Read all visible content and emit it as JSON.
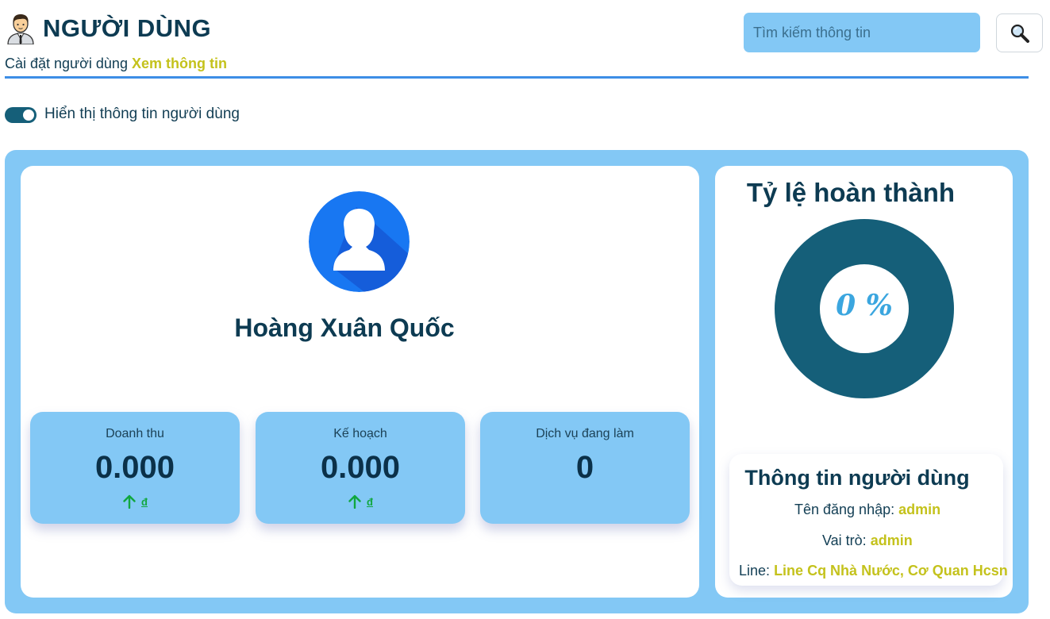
{
  "header": {
    "icon": "person-icon",
    "title": "NGƯỜI DÙNG",
    "breadcrumb_prefix": "Cài đặt người dùng",
    "breadcrumb_active": "Xem thông tin"
  },
  "search": {
    "placeholder": "Tìm kiếm thông tin",
    "value": "",
    "button_icon": "search-icon"
  },
  "toggle": {
    "label": "Hiển thị thông tin người dùng",
    "on": true
  },
  "profile": {
    "name": "Hoàng Xuân Quốc",
    "avatar_icon": "user-avatar-icon"
  },
  "stats": [
    {
      "label": "Doanh thu",
      "value": "0.000",
      "trend_icon": "arrow-up-icon",
      "currency": "đ"
    },
    {
      "label": "Kế hoạch",
      "value": "0.000",
      "trend_icon": "arrow-up-icon",
      "currency": "đ"
    },
    {
      "label": "Dịch vụ đang làm",
      "value": "0"
    }
  ],
  "completion": {
    "title": "Tỷ lệ hoàn thành",
    "label": "0 %",
    "percent": 0
  },
  "user_info": {
    "title": "Thông tin người dùng",
    "username_label": "Tên đăng nhập:",
    "username": "admin",
    "role_label": "Vai trò:",
    "role": "admin",
    "line_label": "Line:",
    "line": "Line Cq Nhà Nước, Cơ Quan Hcsn"
  },
  "colors": {
    "accent": "#83c8f5",
    "dark": "#0d3b52",
    "highlight": "#c4c21c",
    "donut": "#155f79",
    "trend": "#11a73f"
  }
}
